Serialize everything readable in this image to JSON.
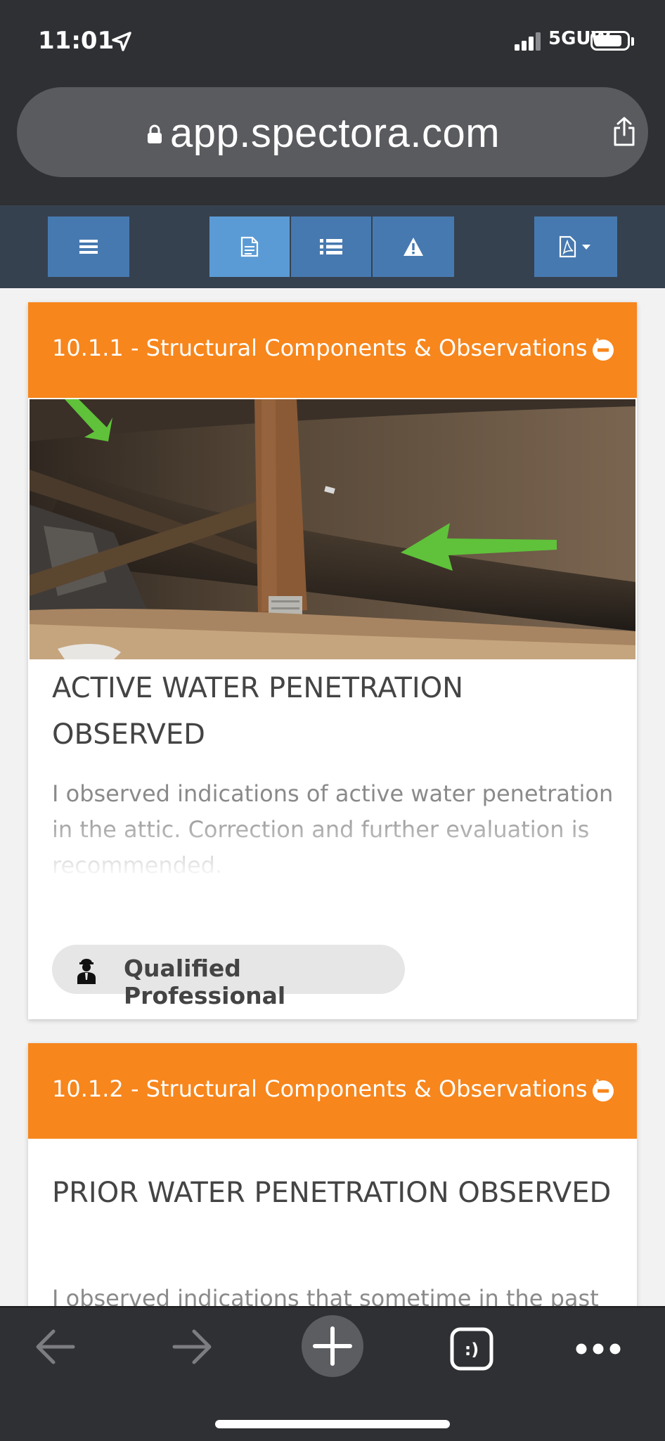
{
  "status_bar": {
    "time": "11:01",
    "network": "5GUW"
  },
  "browser": {
    "url": "app.spectora.com"
  },
  "toolbar": {
    "buttons": [
      {
        "icon": "menu-icon",
        "active": false
      },
      {
        "icon": "document-icon",
        "active": true
      },
      {
        "icon": "list-icon",
        "active": false
      },
      {
        "icon": "warning-icon",
        "active": false
      },
      {
        "icon": "pdf-dropdown-icon",
        "active": false
      }
    ]
  },
  "findings": [
    {
      "header": "10.1.1 - Structural Components & Observations i",
      "has_photo": true,
      "title": "ACTIVE WATER PENETRATION OBSERVED",
      "description": "I observed indications of active water penetration in the attic. Correction and further evaluation is recommended.",
      "recommendation": "Qualified Professional"
    },
    {
      "header": "10.1.2 - Structural Components & Observations i",
      "has_photo": false,
      "title": "PRIOR WATER PENETRATION OBSERVED",
      "description": "I observed indications that sometime in the past there was water penetration or intrusion into the"
    }
  ],
  "colors": {
    "card_header": "#f7861c",
    "toolbar_bg": "#36414f",
    "toolbar_button": "#4679b0",
    "toolbar_button_active": "#5b9bd5"
  }
}
